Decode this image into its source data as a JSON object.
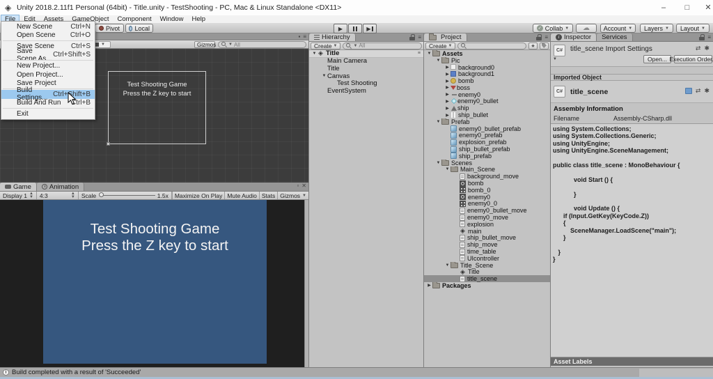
{
  "window": {
    "title": "Unity 2018.2.11f1 Personal (64bit) - Title.unity - TestShooting - PC, Mac & Linux Standalone <DX11>"
  },
  "menubar": {
    "items": [
      "File",
      "Edit",
      "Assets",
      "GameObject",
      "Component",
      "Window",
      "Help"
    ],
    "active_item": "File"
  },
  "file_menu": {
    "items": [
      {
        "label": "New Scene",
        "shortcut": "Ctrl+N"
      },
      {
        "label": "Open Scene",
        "shortcut": "Ctrl+O"
      },
      {
        "separator": true
      },
      {
        "label": "Save Scene",
        "shortcut": "Ctrl+S"
      },
      {
        "label": "Save Scene As...",
        "shortcut": "Ctrl+Shift+S"
      },
      {
        "separator": true
      },
      {
        "label": "New Project..."
      },
      {
        "label": "Open Project..."
      },
      {
        "label": "Save Project"
      },
      {
        "separator": true
      },
      {
        "label": "Build Settings...",
        "shortcut": "Ctrl+Shift+B",
        "highlighted": true
      },
      {
        "label": "Build And Run",
        "shortcut": "Ctrl+B"
      },
      {
        "separator": true
      },
      {
        "label": "Exit"
      }
    ]
  },
  "toolbar": {
    "pivot_label": "Pivot",
    "local_label": "Local",
    "collab_label": "Collab",
    "account_label": "Account",
    "layers_label": "Layers",
    "layout_label": "Layout"
  },
  "scene_view": {
    "gizmos_label": "Gizmos",
    "search_placeholder": "All",
    "canvas_text_line1": "Test Shooting Game",
    "canvas_text_line2": "Press the Z key to start"
  },
  "game_view": {
    "tab_game": "Game",
    "tab_animation": "Animation",
    "display_dropdown": "Display 1",
    "aspect_dropdown": "4:3",
    "scale_label": "Scale",
    "scale_value": "1.5x",
    "buttons": [
      "Maximize On Play",
      "Mute Audio",
      "Stats"
    ],
    "gizmos_label": "Gizmos",
    "screen_line1": "Test Shooting Game",
    "screen_line2": "Press the Z key to start"
  },
  "hierarchy": {
    "tab": "Hierarchy",
    "create_label": "Create",
    "search_placeholder": "All",
    "rows": [
      {
        "indent": 0,
        "expander": "open",
        "icon": "unity",
        "label": "Title",
        "bold": true,
        "header": true
      },
      {
        "indent": 1,
        "label": "Main Camera"
      },
      {
        "indent": 1,
        "label": "Title"
      },
      {
        "indent": 1,
        "expander": "open",
        "label": "Canvas"
      },
      {
        "indent": 2,
        "label": "Test Shooting"
      },
      {
        "indent": 1,
        "label": "EventSystem"
      }
    ]
  },
  "project": {
    "tab": "Project",
    "create_label": "Create",
    "search_placeholder": "",
    "rows": [
      {
        "indent": 0,
        "expander": "open",
        "icon": "folder",
        "label": "Assets",
        "bold": true
      },
      {
        "indent": 1,
        "expander": "open",
        "icon": "folder",
        "label": "Pic"
      },
      {
        "indent": 2,
        "expander": "closed",
        "icon": "sprite-white",
        "label": "background0"
      },
      {
        "indent": 2,
        "expander": "closed",
        "icon": "sprite-blue",
        "label": "background1"
      },
      {
        "indent": 2,
        "expander": "closed",
        "icon": "sprite-bomb",
        "label": "bomb"
      },
      {
        "indent": 2,
        "expander": "closed",
        "icon": "sprite-boss",
        "label": "boss"
      },
      {
        "indent": 2,
        "expander": "closed",
        "icon": "sprite-dash",
        "label": "enemy0"
      },
      {
        "indent": 2,
        "expander": "closed",
        "icon": "sprite-diamond",
        "label": "enemy0_bullet"
      },
      {
        "indent": 2,
        "expander": "closed",
        "icon": "sprite-ship",
        "label": "ship"
      },
      {
        "indent": 2,
        "expander": "closed",
        "icon": "sprite-bars",
        "label": "ship_bullet"
      },
      {
        "indent": 1,
        "expander": "open",
        "icon": "folder",
        "label": "Prefab"
      },
      {
        "indent": 2,
        "icon": "prefab-cube",
        "label": "enemy0_bullet_prefab"
      },
      {
        "indent": 2,
        "icon": "prefab-cube",
        "label": "enemy0_prefab"
      },
      {
        "indent": 2,
        "icon": "prefab-cube",
        "label": "explosion_prefab"
      },
      {
        "indent": 2,
        "icon": "prefab-cube",
        "label": "ship_bullet_prefab"
      },
      {
        "indent": 2,
        "icon": "prefab-cube",
        "label": "ship_prefab"
      },
      {
        "indent": 1,
        "expander": "open",
        "icon": "folder",
        "label": "Scenes"
      },
      {
        "indent": 2,
        "expander": "open",
        "icon": "folder",
        "label": "Main_Scene"
      },
      {
        "indent": 3,
        "icon": "script",
        "label": "background_move"
      },
      {
        "indent": 3,
        "icon": "anim-circle",
        "label": "bomb"
      },
      {
        "indent": 3,
        "icon": "anim-grid",
        "label": "bomb_0"
      },
      {
        "indent": 3,
        "icon": "anim-circle",
        "label": "enemy0"
      },
      {
        "indent": 3,
        "icon": "anim-grid",
        "label": "enemy0_0"
      },
      {
        "indent": 3,
        "icon": "script",
        "label": "enemy0_bullet_move"
      },
      {
        "indent": 3,
        "icon": "script",
        "label": "enemy0_move"
      },
      {
        "indent": 3,
        "icon": "script",
        "label": "explosion"
      },
      {
        "indent": 3,
        "icon": "unity",
        "label": "main"
      },
      {
        "indent": 3,
        "icon": "script",
        "label": "ship_bullet_move"
      },
      {
        "indent": 3,
        "icon": "script",
        "label": "ship_move"
      },
      {
        "indent": 3,
        "icon": "script",
        "label": "time_table"
      },
      {
        "indent": 3,
        "icon": "script",
        "label": "UIcontroller"
      },
      {
        "indent": 2,
        "expander": "open",
        "icon": "folder",
        "label": "Title_Scene"
      },
      {
        "indent": 3,
        "icon": "unity",
        "label": "Title"
      },
      {
        "indent": 3,
        "icon": "script",
        "label": "title_scene",
        "selected": true
      },
      {
        "indent": 0,
        "expander": "closed",
        "icon": "folder",
        "label": "Packages",
        "bold": true
      }
    ]
  },
  "inspector": {
    "tab": "Inspector",
    "tab_services": "Services",
    "header_title": "title_scene Import Settings",
    "open_button": "Open...",
    "execution_order_button": "Execution Order...",
    "imported_object_label": "Imported Object",
    "object_name": "title_scene",
    "csharp_badge": "C#",
    "assembly_heading": "Assembly Information",
    "filename_label": "Filename",
    "filename_value": "Assembly-CSharp.dll",
    "asset_labels_heading": "Asset Labels",
    "code_lines": [
      "using System.Collections;",
      "using System.Collections.Generic;",
      "using UnityEngine;",
      "using UnityEngine.SceneManagement;",
      "",
      "public class title_scene : MonoBehaviour {",
      "",
      "            void Start () {",
      "",
      "            }",
      "",
      "            void Update () {",
      "      if (Input.GetKey(KeyCode.Z))",
      "      {",
      "          SceneManager.LoadScene(\"main\");",
      "      }",
      "",
      "   }",
      "}"
    ]
  },
  "statusbar": {
    "message": "Build completed with a result of 'Succeeded'"
  },
  "colors": {
    "game_screen_blue": "#36577f",
    "menu_highlight": "#9cc9ef",
    "selection_gray": "#8f8f8f"
  }
}
